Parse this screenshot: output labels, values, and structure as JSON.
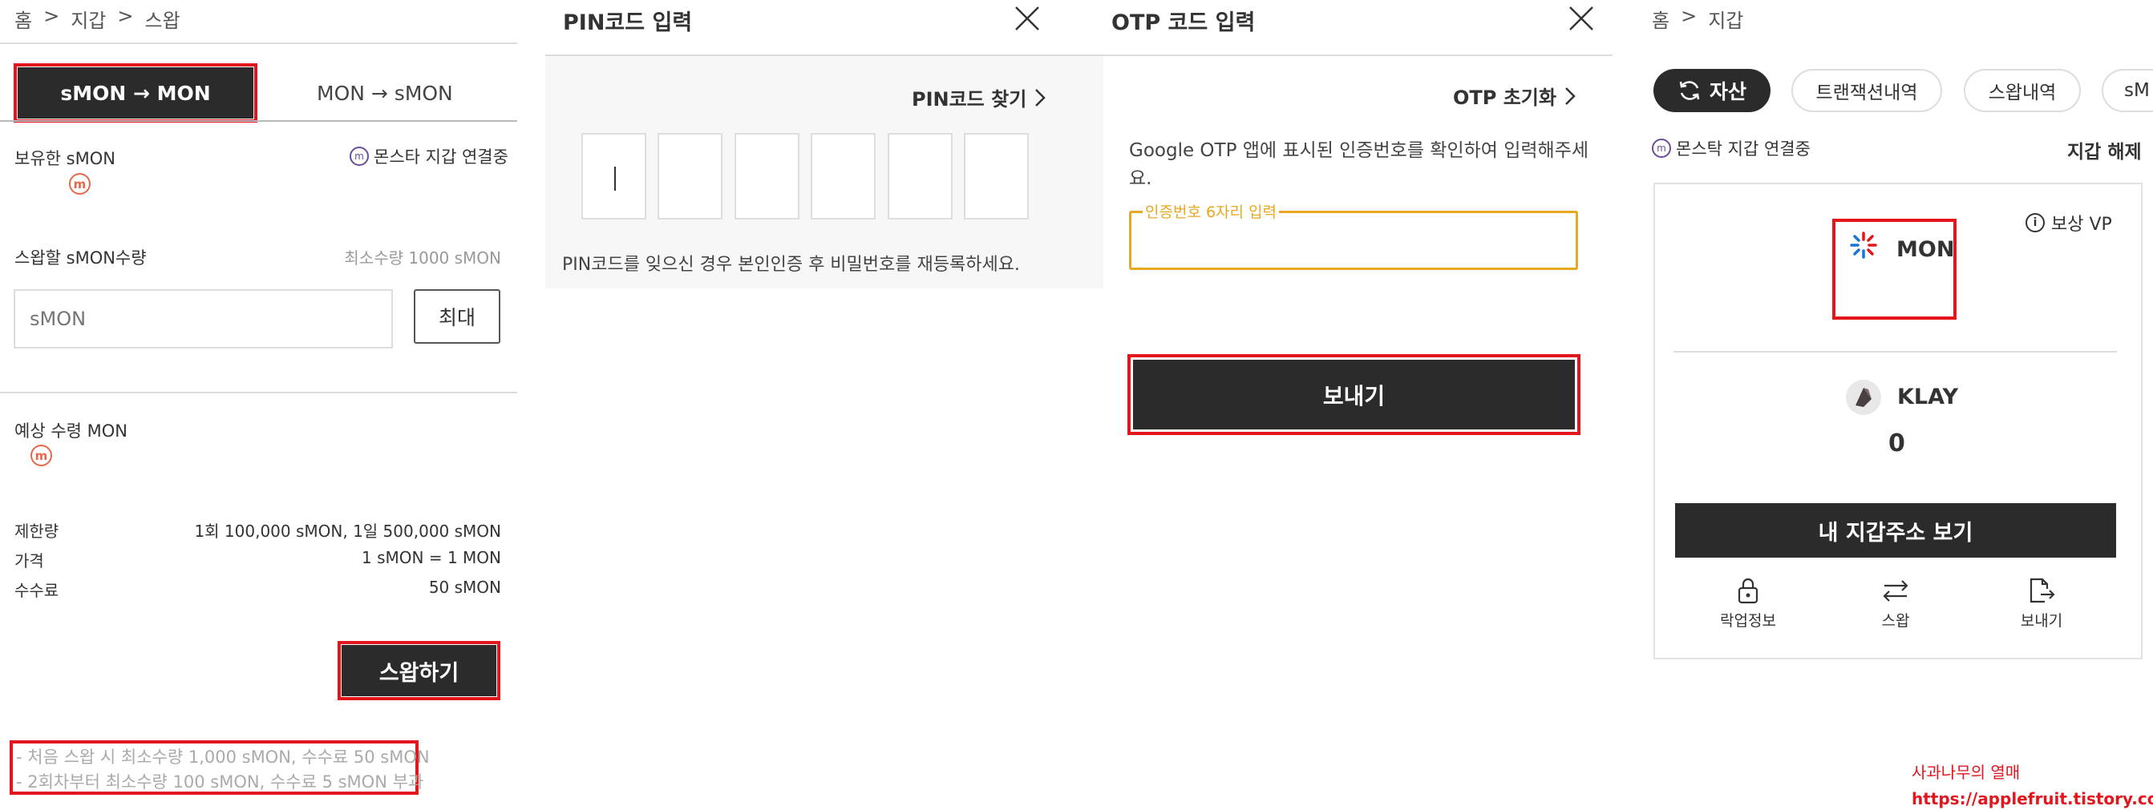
{
  "colors": {
    "accent_red": "#e3151d",
    "dark_button": "#2b2b2b",
    "otp_border": "#e8a820",
    "mon_badge": "#e8674a"
  },
  "panel1": {
    "breadcrumb": [
      "홈",
      ">",
      "지갑",
      ">",
      "스왑"
    ],
    "tabs": [
      "sMON → MON",
      "MON → sMON"
    ],
    "held_label": "보유한 sMON",
    "wallet_status": "몬스타 지갑 연결중",
    "swap_amount_label": "스왑할 sMON수량",
    "min_amount": "최소수량 1000 sMON",
    "input_placeholder": "sMON",
    "max_button": "최대",
    "expected_label": "예상 수령 MON",
    "info_rows": [
      {
        "label": "제한량",
        "value": "1회 100,000 sMON, 1일 500,000 sMON"
      },
      {
        "label": "가격",
        "value": "1 sMON = 1 MON"
      },
      {
        "label": "수수료",
        "value": "50 sMON"
      }
    ],
    "swap_button": "스왑하기",
    "notes": [
      "- 처음 스왑 시 최소수량 1,000 sMON, 수수료 50 sMON",
      "- 2회차부터 최소수량 100 sMON, 수수료 5 sMON 부과"
    ]
  },
  "panel2": {
    "title": "PIN코드 입력",
    "find_link": "PIN코드 찾기",
    "pin_digits": 6,
    "help_text": "PIN코드를 잊으신 경우 본인인증 후 비밀번호를 재등록하세요."
  },
  "panel3": {
    "title": "OTP 코드 입력",
    "reset_link": "OTP 초기화",
    "instruction_line1": "Google OTP 앱에 표시된 인증번호를 확인하여 입력해주세",
    "instruction_line2": "요.",
    "field_label": "인증번호 6자리 입력",
    "send_button": "보내기"
  },
  "panel4": {
    "breadcrumb": [
      "홈",
      ">",
      "지갑"
    ],
    "tabs": [
      "자산",
      "트랜잭션내역",
      "스왑내역",
      "sM"
    ],
    "wallet_status": "몬스탁 지갑 연결중",
    "disconnect": "지갑 해제",
    "reward": "보상 VP",
    "token1": "MON",
    "token2": "KLAY",
    "token2_amount": "0",
    "address_button": "내 지갑주소 보기",
    "actions": [
      "락업정보",
      "스왑",
      "보내기"
    ]
  },
  "watermark": {
    "line1": "사과나무의 열매",
    "line2": "https://applefruit.tistory.com/"
  }
}
